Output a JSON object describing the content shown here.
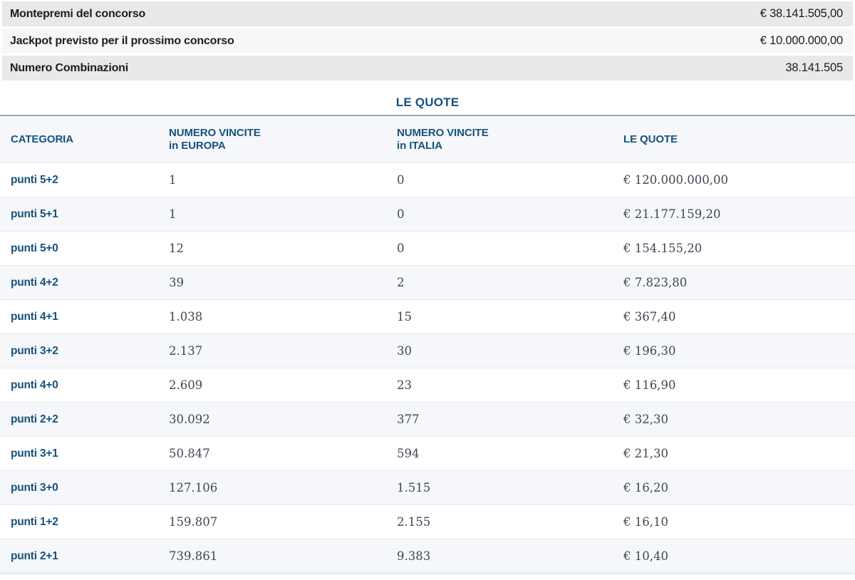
{
  "summary": {
    "rows": [
      {
        "label": "Montepremi del concorso",
        "value": "€ 38.141.505,00"
      },
      {
        "label": "Jackpot previsto per il prossimo concorso",
        "value": "€ 10.000.000,00"
      },
      {
        "label": "Numero Combinazioni",
        "value": "38.141.505"
      }
    ]
  },
  "quote_section": {
    "title": "LE QUOTE",
    "table": {
      "headers": [
        {
          "line1": "CATEGORIA",
          "line2": ""
        },
        {
          "line1": "NUMERO VINCITE",
          "line2": "in EUROPA"
        },
        {
          "line1": "NUMERO VINCITE",
          "line2": "in ITALIA"
        },
        {
          "line1": "LE QUOTE",
          "line2": ""
        }
      ],
      "rows": [
        {
          "category": "punti 5+2",
          "europa": "1",
          "italia": "0",
          "quota": "€ 120.000.000,00"
        },
        {
          "category": "punti 5+1",
          "europa": "1",
          "italia": "0",
          "quota": "€ 21.177.159,20"
        },
        {
          "category": "punti 5+0",
          "europa": "12",
          "italia": "0",
          "quota": "€ 154.155,20"
        },
        {
          "category": "punti 4+2",
          "europa": "39",
          "italia": "2",
          "quota": "€ 7.823,80"
        },
        {
          "category": "punti 4+1",
          "europa": "1.038",
          "italia": "15",
          "quota": "€ 367,40"
        },
        {
          "category": "punti 3+2",
          "europa": "2.137",
          "italia": "30",
          "quota": "€ 196,30"
        },
        {
          "category": "punti 4+0",
          "europa": "2.609",
          "italia": "23",
          "quota": "€ 116,90"
        },
        {
          "category": "punti 2+2",
          "europa": "30.092",
          "italia": "377",
          "quota": "€ 32,30"
        },
        {
          "category": "punti 3+1",
          "europa": "50.847",
          "italia": "594",
          "quota": "€ 21,30"
        },
        {
          "category": "punti 3+0",
          "europa": "127.106",
          "italia": "1.515",
          "quota": "€ 16,20"
        },
        {
          "category": "punti 1+2",
          "europa": "159.807",
          "italia": "2.155",
          "quota": "€ 16,10"
        },
        {
          "category": "punti 2+1",
          "europa": "739.861",
          "italia": "9.383",
          "quota": "€ 10,40"
        }
      ]
    }
  },
  "colors": {
    "accent_blue": "#17527c",
    "bar_gray": "#e9e9e9",
    "bar_light": "#f7f7f7",
    "row_alt": "#f5f7fb",
    "header_bg": "#f5f7fa",
    "divider": "#e3ebf2",
    "title_rule": "#90a8bf",
    "number_text": "#3f4654",
    "summary_text": "#1d1d1b"
  }
}
